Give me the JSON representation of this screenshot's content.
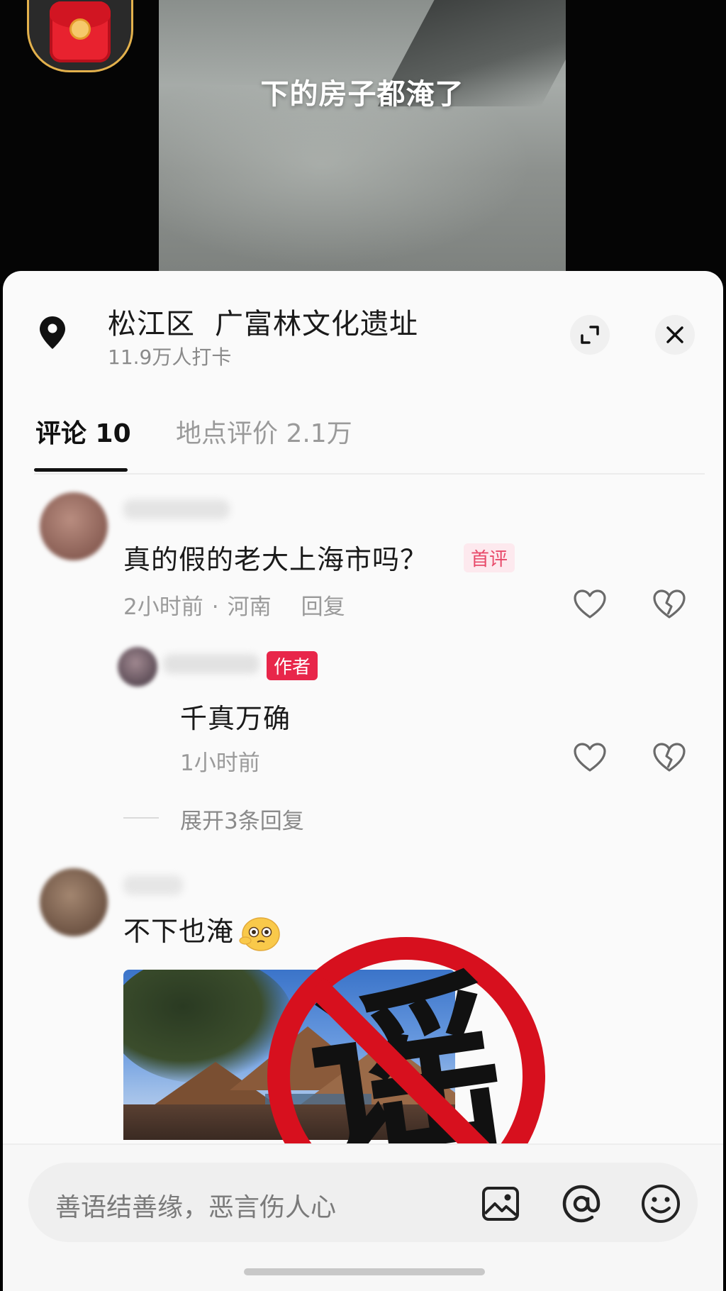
{
  "video": {
    "caption": "下的房子都淹了"
  },
  "location": {
    "district": "松江区",
    "place_name": "广富林文化遗址",
    "checkins": "11.9万人打卡"
  },
  "tabs": {
    "comments_label": "评论 10",
    "reviews_label": "地点评价 2.1万"
  },
  "comments": [
    {
      "text": "真的假的老大上海市吗？",
      "badge": "首评",
      "time": "2小时前",
      "region": "河南",
      "reply_label": "回复"
    },
    {
      "author_badge": "作者",
      "text": "千真万确",
      "time": "1小时前",
      "expand_label": "展开3条回复"
    },
    {
      "text": "不下也淹",
      "emoji": "flushed-face-emoji"
    }
  ],
  "stamp": {
    "character": "谣",
    "ring_color": "#d7101e"
  },
  "input_bar": {
    "placeholder": "善语结善缘，恶言伤人心"
  },
  "colors": {
    "accent": "#e8264a",
    "sheet_bg": "#fafafa"
  }
}
